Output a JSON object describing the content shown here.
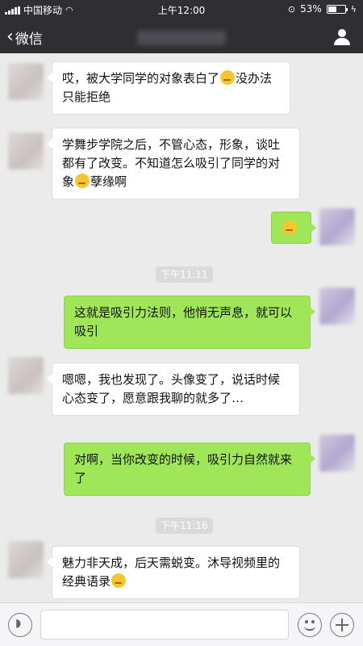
{
  "status": {
    "carrier": "中国移动",
    "time": "上午12:00",
    "battery": "53%",
    "battery_level": 0.53
  },
  "nav": {
    "back_label": "微信"
  },
  "messages": [
    {
      "from": "other",
      "text": "哎，被大学同学的对象表白了",
      "emoji": "unamused-face-emoji",
      "text2": "没办法只能拒绝"
    },
    {
      "from": "other",
      "text": "学舞步学院之后，不管心态，形象，谈吐都有了改变。不知道怎么吸引了同学的对象",
      "emoji": "laughing-crying-emoji",
      "text2": "孽缘啊"
    },
    {
      "from": "me",
      "emoji": "thinking-face-emoji"
    },
    {
      "type": "time",
      "text": "下午11:11"
    },
    {
      "from": "me",
      "text": "这就是吸引力法则，他悄无声息，就可以吸引"
    },
    {
      "from": "other",
      "text": "嗯嗯，我也发现了。头像变了，说话时候心态变了，愿意跟我聊的就多了…"
    },
    {
      "from": "me",
      "text": "对啊，当你改变的时候，吸引力自然就来了"
    },
    {
      "type": "time",
      "text": "下午11:16"
    },
    {
      "from": "other",
      "text": "魅力非天成，后天需蜕变。沐导视频里的经典语录",
      "emoji": "thinking-face-emoji"
    }
  ],
  "input": {
    "placeholder": ""
  }
}
